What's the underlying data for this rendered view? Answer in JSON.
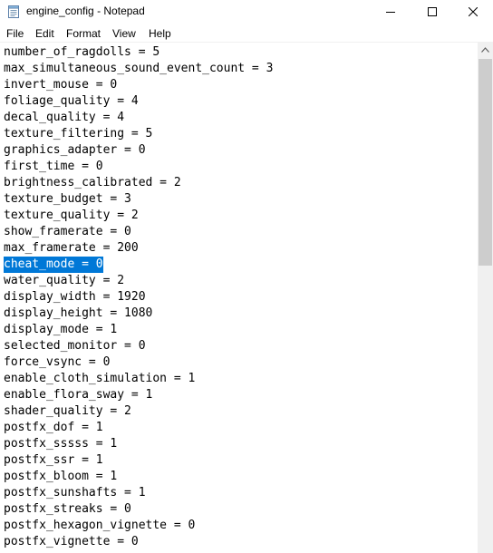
{
  "window": {
    "title": "engine_config - Notepad"
  },
  "icons": {
    "app": "notepad-icon",
    "minimize": "minimize-icon",
    "maximize": "maximize-icon",
    "close": "close-icon",
    "scroll_up": "chevron-up-icon"
  },
  "menu": {
    "items": [
      "File",
      "Edit",
      "Format",
      "View",
      "Help"
    ]
  },
  "editor": {
    "selected_line_index": 13,
    "lines": [
      "number_of_ragdolls = 5",
      "max_simultaneous_sound_event_count = 3",
      "invert_mouse = 0",
      "foliage_quality = 4",
      "decal_quality = 4",
      "texture_filtering = 5",
      "graphics_adapter = 0",
      "first_time = 0",
      "brightness_calibrated = 2",
      "texture_budget = 3",
      "texture_quality = 2",
      "show_framerate = 0",
      "max_framerate = 200",
      "cheat_mode = 0",
      "water_quality = 2",
      "display_width = 1920",
      "display_height = 1080",
      "display_mode = 1",
      "selected_monitor = 0",
      "force_vsync = 0",
      "enable_cloth_simulation = 1",
      "enable_flora_sway = 1",
      "shader_quality = 2",
      "postfx_dof = 1",
      "postfx_sssss = 1",
      "postfx_ssr = 1",
      "postfx_bloom = 1",
      "postfx_sunshafts = 1",
      "postfx_streaks = 0",
      "postfx_hexagon_vignette = 0",
      "postfx_vignette = 0"
    ]
  },
  "colors": {
    "selection": "#0078d7",
    "scrollbar_track": "#f0f0f0",
    "scrollbar_thumb": "#cdcdcd"
  }
}
